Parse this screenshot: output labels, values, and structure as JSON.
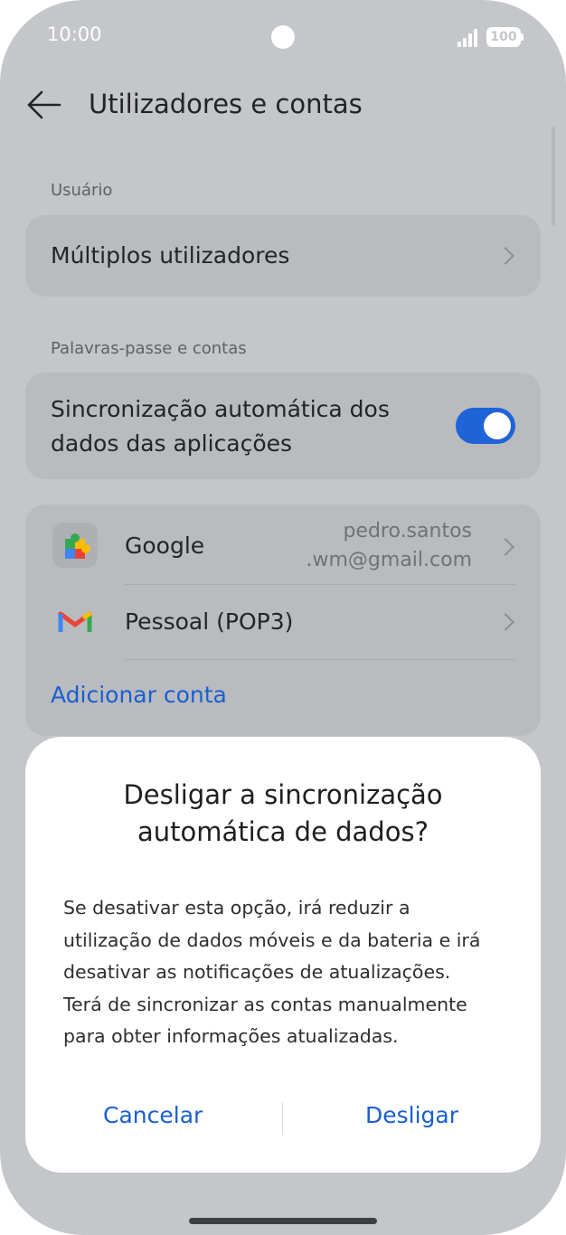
{
  "status_bar": {
    "time": "10:00",
    "battery": "100"
  },
  "header": {
    "title": "Utilizadores e contas"
  },
  "sections": {
    "user_label": "Usuário",
    "passwords_label": "Palavras-passe e contas"
  },
  "user_card": {
    "multiple_users": "Múltiplos utilizadores"
  },
  "sync_card": {
    "label_line1": "Sincronização automática dos",
    "label_line2": "dados das aplicações",
    "toggle_on": true
  },
  "accounts": {
    "google_label": "Google",
    "google_email_line1": "pedro.santos",
    "google_email_line2": ".wm@gmail.com",
    "pop3_label": "Pessoal (POP3)",
    "add_account": "Adicionar conta"
  },
  "dialog": {
    "title_line1": "Desligar a sincronização",
    "title_line2": "automática de dados?",
    "body_lines": [
      "Se desativar esta opção, irá reduzir a",
      "utilização de dados móveis e da bateria e irá",
      "desativar as notificações de atualizações.",
      "Terá de sincronizar as contas manualmente",
      "para obter informações atualizadas."
    ],
    "cancel": "Cancelar",
    "confirm": "Desligar"
  },
  "colors": {
    "accent": "#1a5fd0",
    "toggle": "#1e64d6",
    "background": "#c4c6ca",
    "card": "#b9bbbf"
  },
  "icons": {
    "back": "arrow-left-icon",
    "chevron": "chevron-right-icon",
    "google": "google-play-services-icon",
    "gmail": "gmail-icon"
  }
}
